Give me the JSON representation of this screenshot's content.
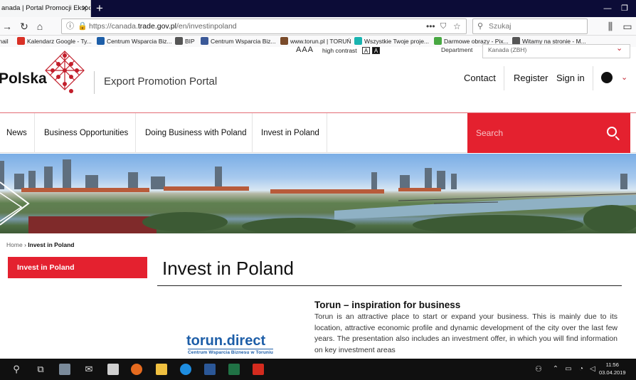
{
  "browser": {
    "tab_title": "anada | Portal Promocji Ekspo",
    "url_prefix": "https://canada.",
    "url_domain": "trade.gov.pl",
    "url_path": "/en/investinpoland",
    "search_placeholder": "Szukaj"
  },
  "bookmarks": [
    {
      "label": "mail",
      "color": "#cc3333"
    },
    {
      "label": "Kalendarz Google - Ty...",
      "color": "#d93025"
    },
    {
      "label": "Centrum Wsparcia Biz...",
      "color": "#1d5ea8"
    },
    {
      "label": "BIP",
      "color": "#555555"
    },
    {
      "label": "Centrum Wsparcia Biz...",
      "color": "#3b5998"
    },
    {
      "label": "www.torun.pl | TORUŃ",
      "color": "#7a4b2a"
    },
    {
      "label": "Wszystkie Twoje proje...",
      "color": "#19b4b0"
    },
    {
      "label": "Darmowe obrazy - Pix...",
      "color": "#48a842"
    },
    {
      "label": "Witamy na stronie - M...",
      "color": "#555555"
    }
  ],
  "header": {
    "font_size_label": "AAA",
    "high_contrast_label": "high contrast",
    "contrast_a_light": "A",
    "contrast_a_dark": "A",
    "department_label": "Department",
    "department_value": "Kanada (ZBH)",
    "logo_text": "Polska",
    "portal_title": "Export Promotion Portal",
    "contact": "Contact",
    "register": "Register",
    "sign_in": "Sign in"
  },
  "nav": {
    "items": [
      "News",
      "Business Opportunities",
      "Doing Business with Poland",
      "Invest in Poland"
    ],
    "search_placeholder": "Search"
  },
  "breadcrumb": {
    "home": "Home",
    "separator": "›",
    "current": "Invest in Poland"
  },
  "sidebar": {
    "active_item": "Invest in Poland"
  },
  "page": {
    "title": "Invest in Poland",
    "partner_logo": "torun.direct",
    "partner_logo_sub": "Centrum Wsparcia Biznesu w Toruniu",
    "article_title": "Torun – inspiration for business",
    "article_text": "Torun is an attractive place to start or expand your business. This is mainly due to its location, attractive economic profile and dynamic development of the city over the last few years. The presentation also includes an investment offer, in which you will find information on key investment areas"
  },
  "taskbar": {
    "time": "11:56",
    "date": "03.04.2019"
  },
  "colors": {
    "brand_red": "#e4212f",
    "nav_dark": "#0c0c37",
    "taskbar": "#101010",
    "torun_blue": "#1d5ea8"
  }
}
